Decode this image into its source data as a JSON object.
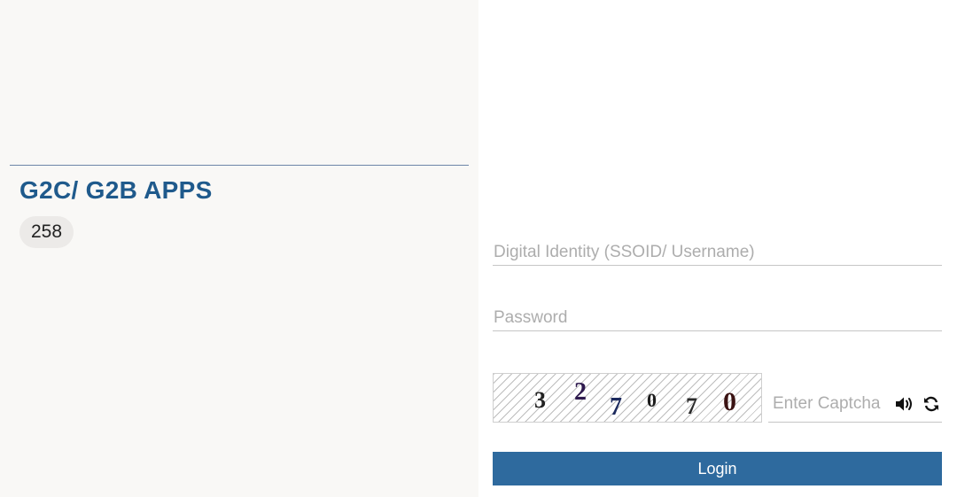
{
  "apps": {
    "title": "G2C/ G2B APPS",
    "count": "258"
  },
  "login_form": {
    "username_placeholder": "Digital Identity (SSOID/ Username)",
    "password_placeholder": "Password",
    "captcha_placeholder": "Enter Captcha",
    "captcha_digits": [
      "3",
      "2",
      "7",
      "0",
      "7",
      "0"
    ],
    "login_label": "Login",
    "audio_icon": "speaker-icon",
    "refresh_icon": "refresh-icon"
  },
  "colors": {
    "accent": "#2e6a9e",
    "title": "#1f5a8c"
  }
}
